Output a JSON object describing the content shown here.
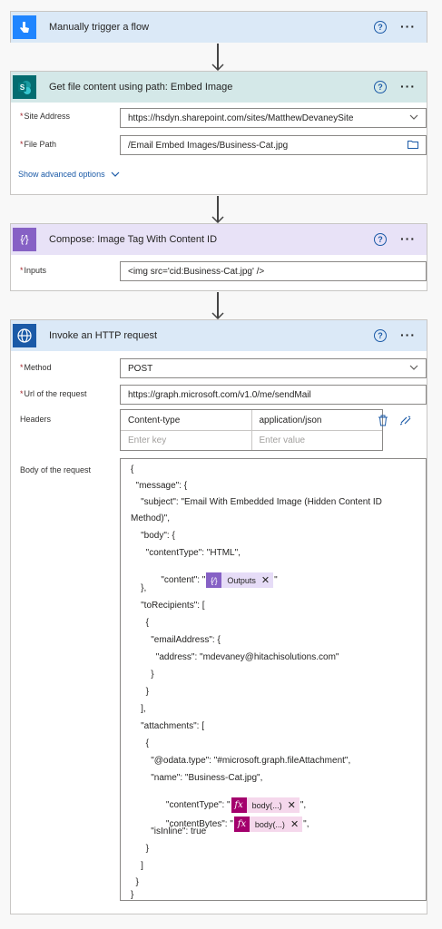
{
  "trigger": {
    "title": "Manually trigger a flow"
  },
  "getfile": {
    "title": "Get file content using path: Embed Image",
    "site_label": "Site Address",
    "site_value": "https://hsdyn.sharepoint.com/sites/MatthewDevaneySite",
    "path_label": "File Path",
    "path_value": "/Email Embed Images/Business-Cat.jpg",
    "advanced": "Show advanced options"
  },
  "compose": {
    "title": "Compose: Image Tag With Content ID",
    "inputs_label": "Inputs",
    "inputs_value": "<img src='cid:Business-Cat.jpg' />"
  },
  "http": {
    "title": "Invoke an HTTP request",
    "method_label": "Method",
    "method_value": "POST",
    "url_label": "Url of the request",
    "url_value": "https://graph.microsoft.com/v1.0/me/sendMail",
    "headers_label": "Headers",
    "header_key": "Content-type",
    "header_value": "application/json",
    "key_placeholder": "Enter key",
    "value_placeholder": "Enter value",
    "body_label": "Body of the request",
    "body_lines": [
      "{",
      "  \"message\": {",
      "    \"subject\": \"Email With Embedded Image (Hidden Content ID",
      "Method)\",",
      "    \"body\": {",
      "      \"contentType\": \"HTML\",",
      "      \"content\": \"",
      "    },",
      "    \"toRecipients\": [",
      "      {",
      "        \"emailAddress\": {",
      "          \"address\": \"mdevaney@hitachisolutions.com\"",
      "        }",
      "      }",
      "    ],",
      "    \"attachments\": [",
      "      {",
      "        \"@odata.type\": \"#microsoft.graph.fileAttachment\",",
      "        \"name\": \"Business-Cat.jpg\",",
      "        \"contentType\": \"",
      "        \"contentBytes\": \"",
      "        \"isInline\": true",
      "      }",
      "    ]",
      "  }",
      "}"
    ],
    "token_outputs": "Outputs",
    "token_body1": "body(...)",
    "token_body2": "body(...)",
    "content_tail": "\"",
    "ct_tail": "\",",
    "cb_tail": "\","
  },
  "common": {
    "help": "?",
    "more": "···",
    "req": "*",
    "x": "✕"
  },
  "colors": {
    "trigger_header": "#dbe9f7",
    "trigger_icon": "#1f85ff",
    "sharepoint_header": "#d4e8e8",
    "sharepoint_icon": "#036c70",
    "compose_header": "#e8e2f7",
    "compose_icon": "#8661c5",
    "http_header": "#dbe9f7",
    "http_icon": "#1b5aa7"
  }
}
